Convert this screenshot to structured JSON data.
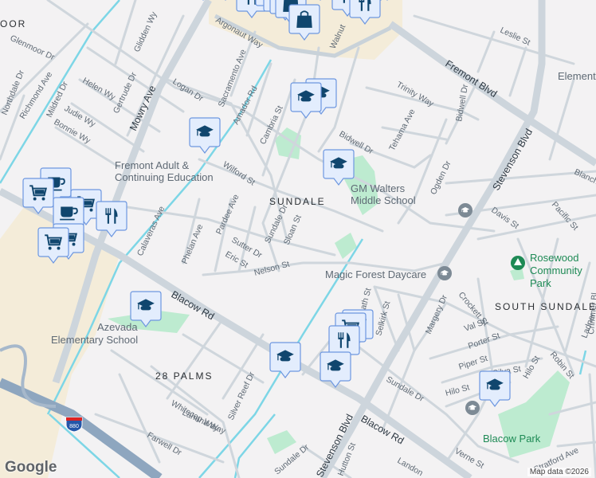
{
  "map": {
    "neighborhoods": [
      "OOR",
      "SUNDALE",
      "28 PALMS",
      "SOUTH SUNDALE"
    ],
    "arterials": [
      "Mowry Ave",
      "Fremont Blvd",
      "Stevenson Blvd",
      "Blacow Rd",
      "Argonaut Way"
    ],
    "streets": [
      "Glenmoor Dr",
      "Northdale Dr",
      "Richmond Ave",
      "Mildred Dr",
      "Helen Wy",
      "Judie Wy",
      "Bonnie Wy",
      "Gertrude Dr",
      "Glidden Wy",
      "Logan Dr",
      "Sacramento Ave",
      "Amador Rd",
      "Cambria St",
      "Wilford St",
      "Pardee Ave",
      "Phelan Ave",
      "Calaveras Ave",
      "Sutter Dr",
      "Sundale Dr",
      "Sloan St",
      "Eric St",
      "Nelson St",
      "Leslie St",
      "Trinity Way",
      "Tehama Ave",
      "Bidwell Dr",
      "Bidwell Dr",
      "Ogden Dr",
      "Davis St",
      "Pacific St",
      "Blanch",
      "Ridpath St",
      "Selkirk St",
      "Margery Dr",
      "Crockett St",
      "Val St",
      "Porter St",
      "Piper St",
      "De Silva St",
      "Hilo St",
      "Hilo St",
      "Robin St",
      "Ladner",
      "Sundale Dr",
      "Lahana Way",
      "Whitecap Way",
      "Silver Reef Dr",
      "Farwell Dr",
      "Verne St",
      "Hutton St",
      "Landon",
      "Sundale Dr",
      "Walnut",
      "Crimmer Bl",
      "Stratford Ave"
    ],
    "pois": [
      "Fremont Adult & Continuing Education",
      "GM Walters Middle School",
      "Magic Forest Daycare",
      "Azevada Elementary School",
      "Element"
    ],
    "parks": [
      "Rosewood Community Park",
      "Blacow Park"
    ],
    "highway_shield": "880",
    "logo": "Google",
    "attribution": "Map data ©2026"
  },
  "colors": {
    "background": "#f3f2f3",
    "park": "#bdebd0",
    "commercial": "#f4ecd9",
    "water": "#7dd6e6",
    "pin": "#e3edfd",
    "icon": "#10466e"
  }
}
